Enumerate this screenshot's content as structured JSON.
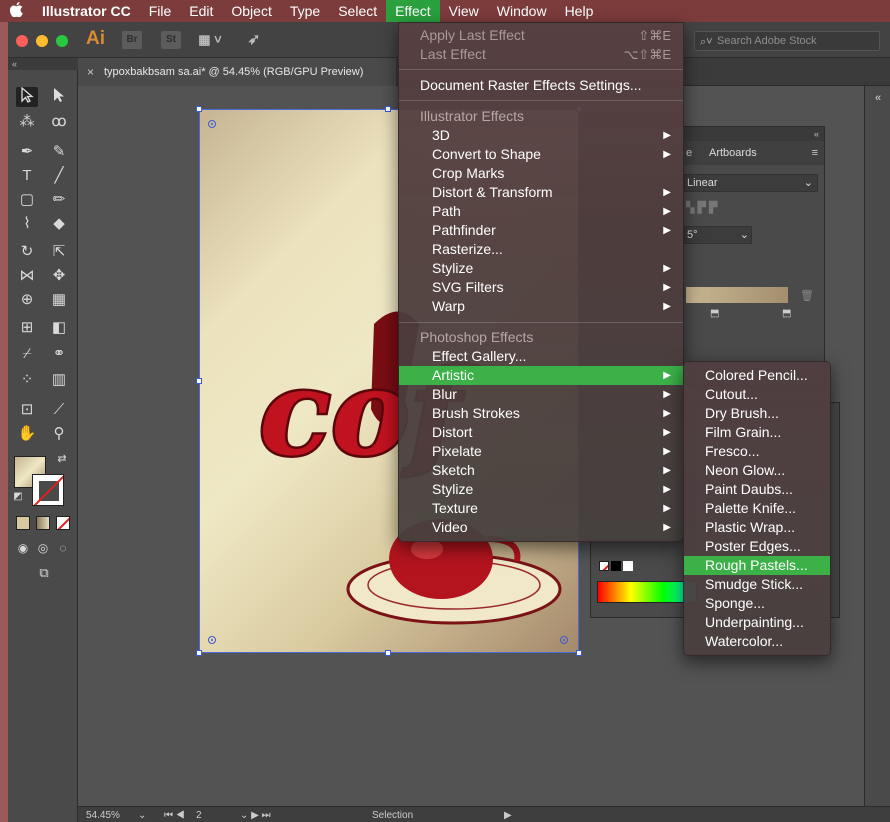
{
  "menubar": {
    "app_name": "Illustrator CC",
    "items": [
      "File",
      "Edit",
      "Object",
      "Type",
      "Select",
      "Effect",
      "View",
      "Window",
      "Help"
    ],
    "active_item": "Effect",
    "colors": {
      "bar": "#7c3c3c",
      "highlight": "#2aa13e"
    }
  },
  "appbar": {
    "logo": "Ai",
    "bridge_label": "Br",
    "stock_label": "St",
    "search_placeholder": "Search Adobe Stock"
  },
  "document": {
    "tab_title": "typoxbakbsam sa.ai* @ 54.45% (RGB/GPU Preview)",
    "artwork_text": "cof"
  },
  "panels": {
    "gradient_tab_fragment": "e",
    "artboards_tab": "Artboards",
    "gradient_type": "Linear",
    "angle_fragment": "5°"
  },
  "statusbar": {
    "zoom": "54.45%",
    "artboard_number": "2",
    "current_tool": "Selection"
  },
  "effect_menu": {
    "apply_last": {
      "label": "Apply Last Effect",
      "shortcut": "⇧⌘E"
    },
    "last_effect": {
      "label": "Last Effect",
      "shortcut": "⌥⇧⌘E"
    },
    "raster_settings": "Document Raster Effects Settings...",
    "illustrator_header": "Illustrator Effects",
    "illustrator_items": [
      {
        "label": "3D",
        "submenu": true
      },
      {
        "label": "Convert to Shape",
        "submenu": true
      },
      {
        "label": "Crop Marks",
        "submenu": false
      },
      {
        "label": "Distort & Transform",
        "submenu": true
      },
      {
        "label": "Path",
        "submenu": true
      },
      {
        "label": "Pathfinder",
        "submenu": true
      },
      {
        "label": "Rasterize...",
        "submenu": false
      },
      {
        "label": "Stylize",
        "submenu": true
      },
      {
        "label": "SVG Filters",
        "submenu": true
      },
      {
        "label": "Warp",
        "submenu": true
      }
    ],
    "photoshop_header": "Photoshop Effects",
    "photoshop_items": [
      {
        "label": "Effect Gallery...",
        "submenu": false
      },
      {
        "label": "Artistic",
        "submenu": true
      },
      {
        "label": "Blur",
        "submenu": true
      },
      {
        "label": "Brush Strokes",
        "submenu": true
      },
      {
        "label": "Distort",
        "submenu": true
      },
      {
        "label": "Pixelate",
        "submenu": true
      },
      {
        "label": "Sketch",
        "submenu": true
      },
      {
        "label": "Stylize",
        "submenu": true
      },
      {
        "label": "Texture",
        "submenu": true
      },
      {
        "label": "Video",
        "submenu": true
      }
    ],
    "highlighted": "Artistic"
  },
  "artistic_submenu": {
    "items": [
      "Colored Pencil...",
      "Cutout...",
      "Dry Brush...",
      "Film Grain...",
      "Fresco...",
      "Neon Glow...",
      "Paint Daubs...",
      "Palette Knife...",
      "Plastic Wrap...",
      "Poster Edges...",
      "Rough Pastels...",
      "Smudge Stick...",
      "Sponge...",
      "Underpainting...",
      "Watercolor..."
    ],
    "highlighted": "Rough Pastels...",
    "highlight_color": "#3bb148"
  }
}
